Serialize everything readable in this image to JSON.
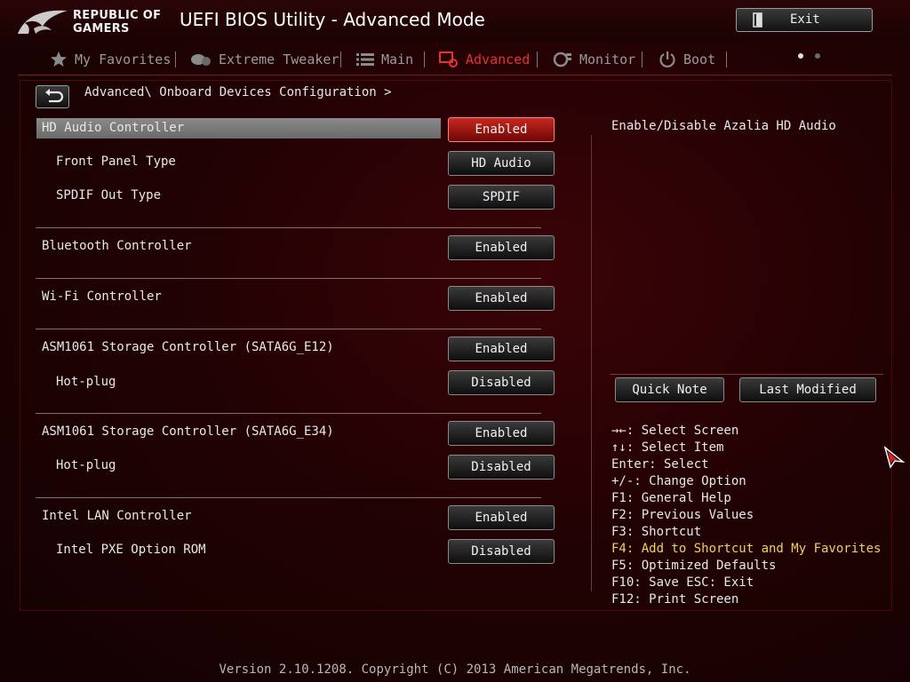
{
  "header": {
    "logo_line1": "REPUBLIC OF",
    "logo_line2": "GAMERS",
    "title": "UEFI BIOS Utility - Advanced Mode",
    "exit_label": "Exit"
  },
  "nav": {
    "tabs": [
      {
        "label": "My Favorites",
        "icon": "star-icon",
        "active": false
      },
      {
        "label": "Extreme Tweaker",
        "icon": "tweaker-icon",
        "active": false
      },
      {
        "label": "Main",
        "icon": "list-icon",
        "active": false
      },
      {
        "label": "Advanced",
        "icon": "advanced-icon",
        "active": true
      },
      {
        "label": "Monitor",
        "icon": "monitor-gauge-icon",
        "active": false
      },
      {
        "label": "Boot",
        "icon": "power-icon",
        "active": false
      }
    ],
    "active_color": "#e0362f"
  },
  "breadcrumb": "Advanced\\ Onboard Devices Configuration >",
  "settings": [
    {
      "label": "HD Audio Controller",
      "value": "Enabled",
      "selected": true
    },
    {
      "label": "Front Panel Type",
      "value": "HD Audio"
    },
    {
      "label": "SPDIF Out Type",
      "value": "SPDIF"
    },
    {
      "label": "Bluetooth Controller",
      "value": "Enabled"
    },
    {
      "label": "Wi-Fi Controller",
      "value": "Enabled"
    },
    {
      "label": "ASM1061 Storage Controller (SATA6G_E12)",
      "value": "Enabled"
    },
    {
      "label": "Hot-plug",
      "value": "Disabled"
    },
    {
      "label": "ASM1061 Storage Controller (SATA6G_E34)",
      "value": "Enabled"
    },
    {
      "label": "Hot-plug",
      "value": "Disabled"
    },
    {
      "label": "Intel LAN Controller",
      "value": "Enabled"
    },
    {
      "label": "Intel PXE Option ROM",
      "value": "Disabled"
    }
  ],
  "help": {
    "description": "Enable/Disable Azalia HD Audio",
    "quick_note_label": "Quick Note",
    "last_modified_label": "Last Modified",
    "keys": [
      "→←: Select Screen",
      "↑↓: Select Item",
      "Enter: Select",
      "+/-: Change Option",
      "F1: General Help",
      "F2: Previous Values",
      "F3: Shortcut",
      "F4: Add to Shortcut and My Favorites",
      "F5: Optimized Defaults",
      "F10: Save  ESC: Exit",
      "F12: Print Screen"
    ],
    "highlight_color": "#f0d060"
  },
  "footer": "Version 2.10.1208. Copyright (C) 2013 American Megatrends, Inc.",
  "colors": {
    "background": "#220204",
    "selected_button": "#c8281e",
    "row_highlight": "#7a7a7a"
  }
}
